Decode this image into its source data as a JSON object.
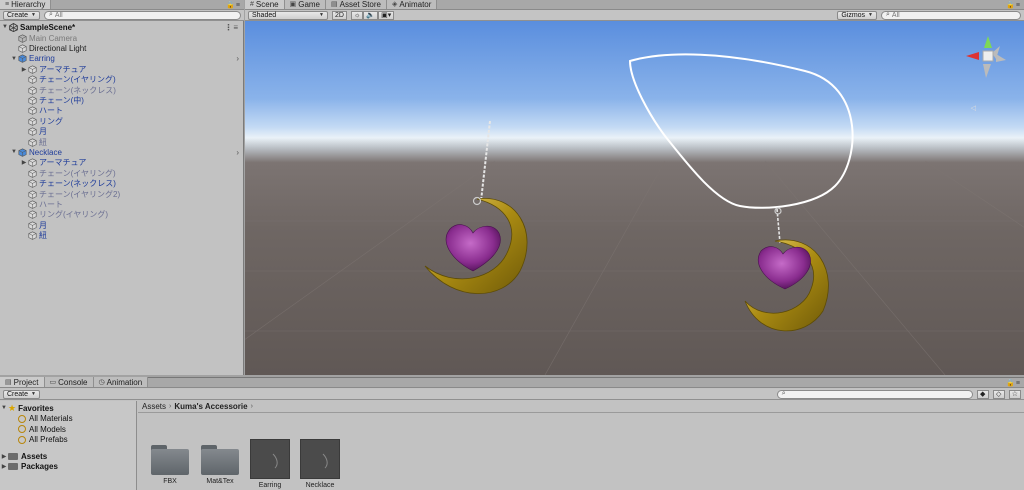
{
  "hierarchy": {
    "tab_label": "Hierarchy",
    "create_label": "Create",
    "search_placeholder": "All",
    "scene_name": "SampleScene*",
    "items": [
      {
        "label": "Main Camera",
        "depth": 1,
        "style": "gray",
        "fold": "",
        "chev": false
      },
      {
        "label": "Directional Light",
        "depth": 1,
        "style": "plain",
        "fold": "",
        "chev": false
      },
      {
        "label": "Earring",
        "depth": 1,
        "style": "blue",
        "fold": "open",
        "chev": true
      },
      {
        "label": "アーマチュア",
        "depth": 2,
        "style": "blue",
        "fold": "closed",
        "chev": false
      },
      {
        "label": "チェーン(イヤリング)",
        "depth": 2,
        "style": "blue",
        "fold": "",
        "chev": false
      },
      {
        "label": "チェーン(ネックレス)",
        "depth": 2,
        "style": "faded",
        "fold": "",
        "chev": false
      },
      {
        "label": "チェーン(中)",
        "depth": 2,
        "style": "blue",
        "fold": "",
        "chev": false
      },
      {
        "label": "ハート",
        "depth": 2,
        "style": "blue",
        "fold": "",
        "chev": false
      },
      {
        "label": "リング",
        "depth": 2,
        "style": "blue",
        "fold": "",
        "chev": false
      },
      {
        "label": "月",
        "depth": 2,
        "style": "blue",
        "fold": "",
        "chev": false
      },
      {
        "label": "紐",
        "depth": 2,
        "style": "faded",
        "fold": "",
        "chev": false
      },
      {
        "label": "Necklace",
        "depth": 1,
        "style": "blue",
        "fold": "open",
        "chev": true
      },
      {
        "label": "アーマチュア",
        "depth": 2,
        "style": "blue",
        "fold": "closed",
        "chev": false
      },
      {
        "label": "チェーン(イヤリング)",
        "depth": 2,
        "style": "faded",
        "fold": "",
        "chev": false
      },
      {
        "label": "チェーン(ネックレス)",
        "depth": 2,
        "style": "blue",
        "fold": "",
        "chev": false
      },
      {
        "label": "チェーン(イヤリング2)",
        "depth": 2,
        "style": "faded",
        "fold": "",
        "chev": false
      },
      {
        "label": "ハート",
        "depth": 2,
        "style": "faded",
        "fold": "",
        "chev": false
      },
      {
        "label": "リング(イヤリング)",
        "depth": 2,
        "style": "faded",
        "fold": "",
        "chev": false
      },
      {
        "label": "月",
        "depth": 2,
        "style": "blue",
        "fold": "",
        "chev": false
      },
      {
        "label": "紐",
        "depth": 2,
        "style": "blue",
        "fold": "",
        "chev": false
      }
    ]
  },
  "scene": {
    "tabs": [
      {
        "label": "Scene",
        "icon": "#",
        "active": true
      },
      {
        "label": "Game",
        "icon": "▣",
        "active": false
      },
      {
        "label": "Asset Store",
        "icon": "▤",
        "active": false
      },
      {
        "label": "Animator",
        "icon": "◈",
        "active": false
      }
    ],
    "shading_mode": "Shaded",
    "mode_2d": "2D",
    "gizmos_label": "Gizmos",
    "search_placeholder": "All"
  },
  "project": {
    "tabs": [
      {
        "label": "Project",
        "icon": "▤",
        "active": true
      },
      {
        "label": "Console",
        "icon": "▭",
        "active": false
      },
      {
        "label": "Animation",
        "icon": "◷",
        "active": false
      }
    ],
    "create_label": "Create",
    "favorites_label": "Favorites",
    "favorites": [
      "All Materials",
      "All Models",
      "All Prefabs"
    ],
    "roots": [
      "Assets",
      "Packages"
    ],
    "breadcrumb": [
      "Assets",
      "Kuma's Accessorie"
    ],
    "assets": [
      {
        "label": "FBX",
        "kind": "folder"
      },
      {
        "label": "Mat&Tex",
        "kind": "folder"
      },
      {
        "label": "Earring",
        "kind": "prefab"
      },
      {
        "label": "Necklace",
        "kind": "prefab"
      }
    ]
  },
  "colors": {
    "hier_blue": "#1f3c9a",
    "gold": "#b89a1c",
    "heart": "#8a2d8f"
  }
}
